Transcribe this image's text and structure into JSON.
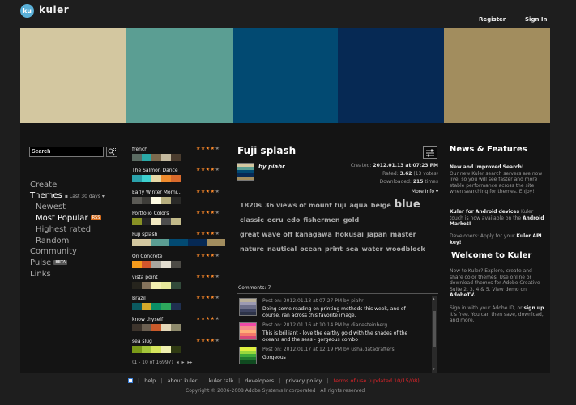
{
  "header": {
    "logo": "ku",
    "brand": "kuler",
    "register": "Register",
    "signin": "Sign In"
  },
  "palette": [
    "#d3c7a0",
    "#5b9e93",
    "#024a72",
    "#062954",
    "#a28d5e"
  ],
  "search": {
    "value": "Search"
  },
  "nav": {
    "create": "Create",
    "themes": "Themes",
    "themes_range": "Last 30 days",
    "newest": "Newest",
    "most_popular": "Most Popular",
    "most_popular_badge": "RSS",
    "highest_rated": "Highest rated",
    "random": "Random",
    "community": "Community",
    "pulse": "Pulse",
    "pulse_badge": "BETA",
    "links": "Links"
  },
  "themes": [
    {
      "name": "french",
      "stars": 4,
      "colors": [
        "#5b6b62",
        "#2aa9a7",
        "#7c6a4e",
        "#c4b99e",
        "#4a3c2e"
      ]
    },
    {
      "name": "The Salmon Dance",
      "stars": 4,
      "colors": [
        "#2aa1ab",
        "#3ed1d0",
        "#e6d8a6",
        "#ef8a2d",
        "#d96a2c"
      ]
    },
    {
      "name": "Early Winter Morni...",
      "stars": 4,
      "colors": [
        "#5b5a55",
        "#3e3d39",
        "#fefbe3",
        "#b6ae7e",
        "#2a2a28"
      ]
    },
    {
      "name": "Portfolio Colors",
      "stars": 4,
      "colors": [
        "#889125",
        "#262626",
        "#f1e8c1",
        "#4d4d4d",
        "#c2ba8a"
      ]
    },
    {
      "name": "Fuji splash",
      "stars": 4,
      "colors": [
        "#d3c7a0",
        "#5b9e93",
        "#024a72",
        "#062954",
        "#a28d5e"
      ]
    },
    {
      "name": "On Concrete",
      "stars": 4,
      "colors": [
        "#f59b1c",
        "#d2562c",
        "#a7a59e",
        "#e2ddd0",
        "#4d4b46"
      ]
    },
    {
      "name": "vista point",
      "stars": 4,
      "colors": [
        "#26241d",
        "#85735c",
        "#f2eeb0",
        "#e6e89b",
        "#324a3a"
      ]
    },
    {
      "name": "Brazil",
      "stars": 4,
      "colors": [
        "#0b5a60",
        "#d4a92a",
        "#0b8e67",
        "#2da85c",
        "#1f2f50"
      ]
    },
    {
      "name": "know thyself",
      "stars": 4,
      "colors": [
        "#3d342c",
        "#6b5f51",
        "#c95a2a",
        "#e3d7b8",
        "#8e8a6c"
      ]
    },
    {
      "name": "sea slug",
      "stars": 4,
      "colors": [
        "#7a9a18",
        "#a4c63a",
        "#d6e55d",
        "#f0f0b0",
        "#2f3a12"
      ]
    }
  ],
  "pager": "(1 - 10 of 16997)",
  "detail": {
    "title": "Fuji splash",
    "by_prefix": "by",
    "author": "piahr",
    "created_label": "Created:",
    "created": "2012.01.13 at 07:23 PM",
    "rated_label": "Rated:",
    "rated": "3.62",
    "rated_votes": "(13 votes)",
    "downloaded_label": "Downloaded:",
    "downloaded": "215",
    "downloaded_suffix": "times",
    "more_info": "More Info",
    "tags": [
      {
        "t": "1820s",
        "s": 8
      },
      {
        "t": "36 views of mount fuji",
        "s": 8
      },
      {
        "t": "aqua",
        "s": 8
      },
      {
        "t": "beige",
        "s": 8
      },
      {
        "t": "blue",
        "s": 13
      },
      {
        "t": "classic",
        "s": 8
      },
      {
        "t": "ecru",
        "s": 8
      },
      {
        "t": "edo",
        "s": 8
      },
      {
        "t": "fishermen",
        "s": 8
      },
      {
        "t": "gold",
        "s": 8
      },
      {
        "t": "great wave off kanagawa",
        "s": 8
      },
      {
        "t": "hokusai",
        "s": 8
      },
      {
        "t": "japan",
        "s": 8
      },
      {
        "t": "master",
        "s": 8
      },
      {
        "t": "nature",
        "s": 8
      },
      {
        "t": "nautical",
        "s": 8
      },
      {
        "t": "ocean",
        "s": 8
      },
      {
        "t": "print",
        "s": 8
      },
      {
        "t": "sea",
        "s": 8
      },
      {
        "t": "water",
        "s": 8
      },
      {
        "t": "woodblock",
        "s": 8
      }
    ]
  },
  "comments": {
    "header": "Comments: 7",
    "items": [
      {
        "meta": "Post on: 2012.01.13 at 07:27 PM by piahr",
        "text": "Doing some reading on printing methods this week, and of course, ran across this favorite image.",
        "thumb": [
          "#b9b09a",
          "#9c9ab2",
          "#6d6f8a",
          "#3f4562",
          "#2d3348"
        ]
      },
      {
        "meta": "Post on: 2012.01.16 at 10:14 PM by dianesteinberg",
        "text": "This is brilliant - love the earthy gold with the shades of the oceans and the seas - gorgeous combo",
        "thumb": [
          "#f04aa8",
          "#f68c8c",
          "#ffb07a",
          "#f47a6a",
          "#d64878"
        ]
      },
      {
        "meta": "Post on: 2012.01.17 at 12:19 PM by usha.datadrafters",
        "text": "Gorgeous",
        "thumb": [
          "#e0f040",
          "#98d83c",
          "#3ea83a",
          "#207a2e",
          "#104a20"
        ]
      }
    ]
  },
  "right": {
    "news_title": "News & Features",
    "news1_title": "New and Improved Search!",
    "news1_text": "Our new Kuler search servers are now live, so you will see faster and more stable performance across the site when searching for themes.  Enjoy!",
    "news2_title": "Kuler for Android devices",
    "news2_text": " Kuler touch is now available on the ",
    "news2_link": "Android Market!",
    "news3_text": "Developers: Apply for your ",
    "news3_link": "Kuler API key!",
    "welcome_title": "Welcome to Kuler",
    "welcome_text": "New to Kuler? Explore, create and share color themes. Use online or download themes for Adobe Creative Suite 2, 3, 4 & 5. View demo on ",
    "welcome_link": "AdobeTV.",
    "signin_text": "Sign in with your Adobe ID, or ",
    "signin_link": "sign up",
    "signin_text2": ". It's free. You can then save, download, and more."
  },
  "footer": {
    "help": "help",
    "about": "about kuler",
    "talk": "kuler talk",
    "developers": "developers",
    "privacy": "privacy policy",
    "terms": "terms of use (updated 10/15/08)",
    "copyright": "Copyright © 2006-2008 Adobe Systems Incorporated  |  All rights reserved"
  }
}
